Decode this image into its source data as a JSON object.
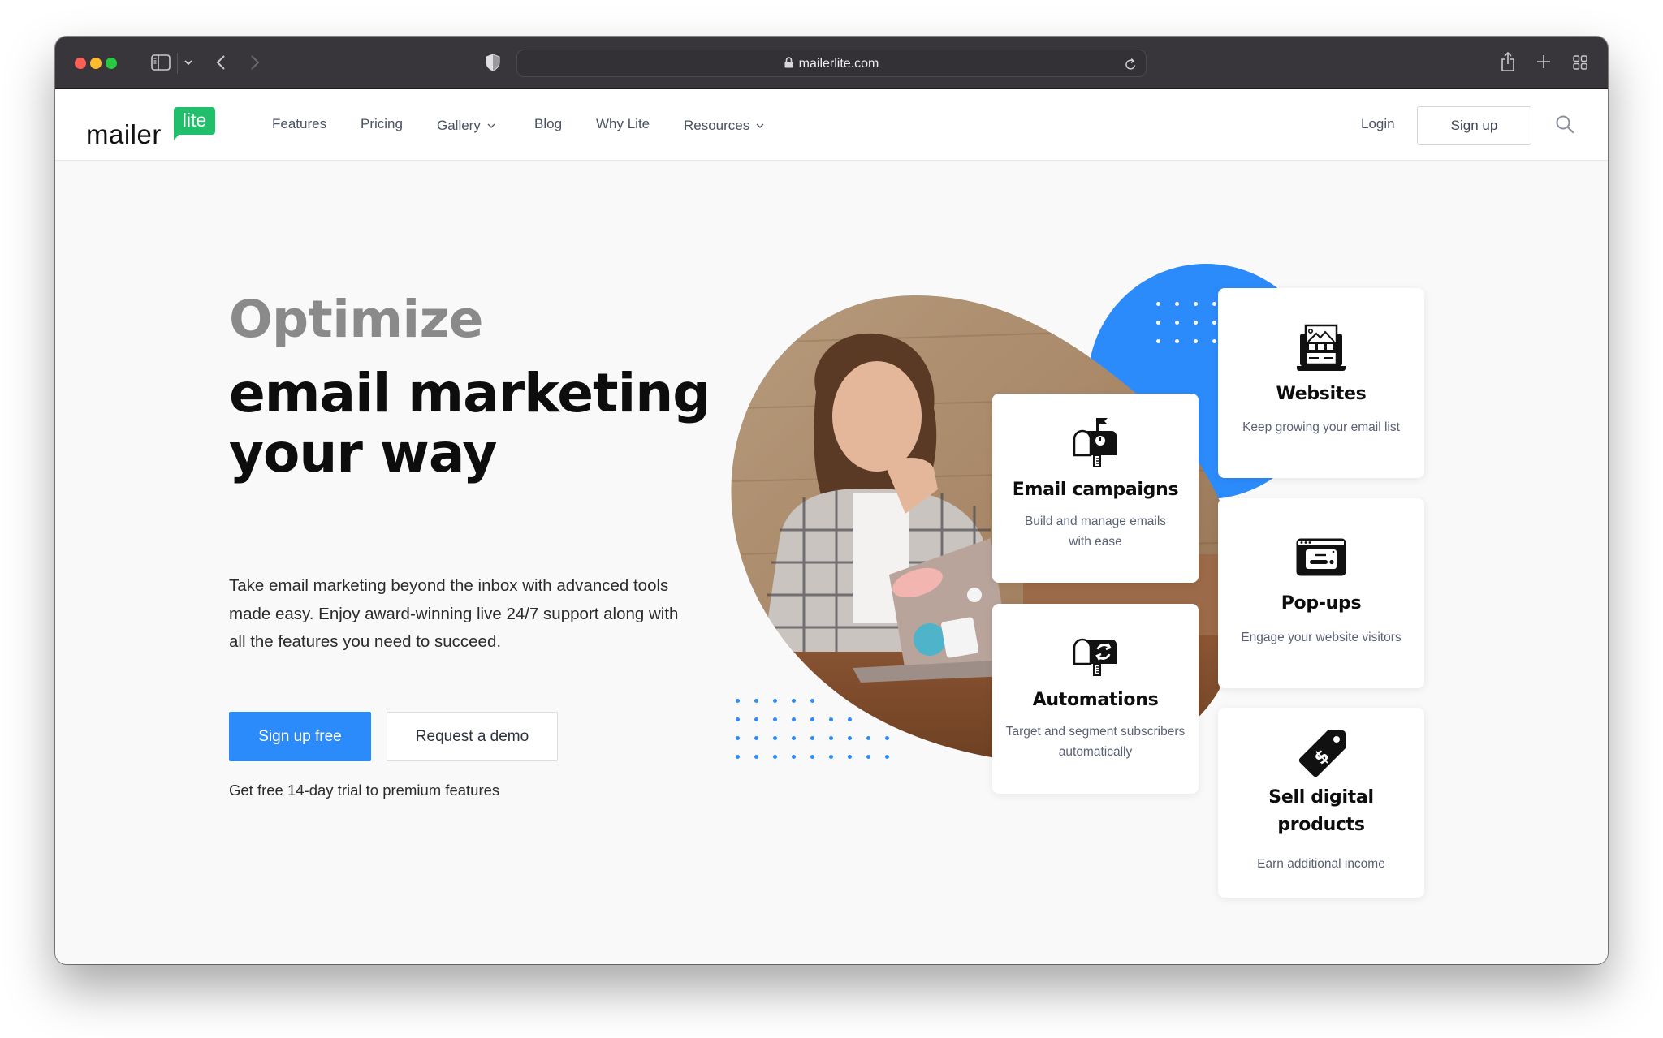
{
  "browser": {
    "url": "mailerlite.com",
    "icons": [
      "sidebar-icon",
      "chevron-down-icon",
      "back-icon",
      "forward-icon",
      "shield-icon",
      "lock-icon",
      "reload-icon",
      "share-icon",
      "new-tab-icon",
      "tab-overview-icon"
    ]
  },
  "nav": {
    "logo_main": "mailer",
    "logo_badge": "lite",
    "items": [
      {
        "label": "Features",
        "dropdown": false
      },
      {
        "label": "Pricing",
        "dropdown": false
      },
      {
        "label": "Gallery",
        "dropdown": true
      },
      {
        "label": "Blog",
        "dropdown": false
      },
      {
        "label": "Why Lite",
        "dropdown": false
      },
      {
        "label": "Resources",
        "dropdown": true
      }
    ],
    "login": "Login",
    "signup": "Sign up"
  },
  "hero": {
    "eyebrow": "Optimize",
    "title_line1": "email marketing",
    "title_line2": "your way",
    "description": "Take email marketing beyond the inbox with advanced tools made easy. Enjoy award-winning live 24/7 support along with all the features you need to succeed.",
    "primary_cta": "Sign up free",
    "secondary_cta": "Request a demo",
    "trial_note": "Get free 14-day trial to premium features"
  },
  "features": [
    {
      "title": "Email campaigns",
      "description": "Build and manage emails with ease",
      "icon": "mailbox-icon"
    },
    {
      "title": "Automations",
      "description": "Target and segment subscribers automatically",
      "icon": "mailbox-sync-icon"
    },
    {
      "title": "Websites",
      "description": "Keep growing your email list",
      "icon": "website-laptop-icon"
    },
    {
      "title": "Pop-ups",
      "description": "Engage your website visitors",
      "icon": "popup-window-icon"
    },
    {
      "title": "Sell digital products",
      "description": "Earn additional income",
      "icon": "price-tag-icon"
    }
  ],
  "colors": {
    "brand_green": "#21bf6b",
    "accent_blue": "#2c8bfb",
    "heading": "#0d0d0d",
    "eyebrow": "#8a8a8a",
    "muted_text": "#5a6173"
  }
}
